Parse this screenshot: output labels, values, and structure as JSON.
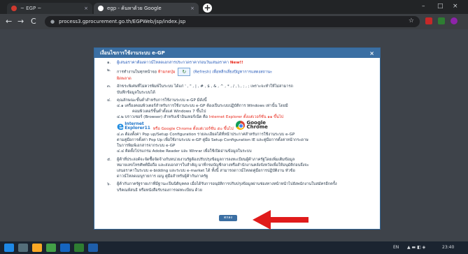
{
  "tabs": [
    {
      "label": "~ EGP ~",
      "close": "×"
    },
    {
      "label": "egp - ค้นหาด้วย Google",
      "close": "×"
    }
  ],
  "new_tab": "+",
  "window_controls": [
    "–",
    "□",
    "×"
  ],
  "nav": {
    "back": "←",
    "forward": "→",
    "reload": "C"
  },
  "address": {
    "url": "process3.gprocurement.go.th/EGPWeb/jsp/index.jsp"
  },
  "bookmark": "☆",
  "dialog": {
    "title": "เงื่อนไขการใช้งานระบบ e-GP",
    "close": "×",
    "items": {
      "i1_num": "๑.",
      "i1_text": "ผู้เสนอราคาต้องดาวน์โหลดเอกสารประกวดราคาก่อนวันเสนอราคา",
      "i1_new": "New!!",
      "i2_num": "๒.",
      "i2_a": "การทำงานในทุกหน้าจอ",
      "i2_b": "ห้ามกดปุ่ม",
      "i2_icon": "↻",
      "i2_c": "(Refresh)",
      "i2_d": "เพื่อหลีกเลี่ยงปัญหาการแสดงสถานะ",
      "i2_e": "ผิดพลาด",
      "i3_num": "๓.",
      "i3_text": "อักขระพิเศษที่ไม่ควรพิมพ์ในระบบ ได้แก่ ' , \" , | , # , $ , & , ^ , * , / , \\ , ; , ; เพราะจะทำให้ไม่สามารถ",
      "i3_text2": "บันทึกข้อมูลในระบบได้",
      "i4_num": "๔.",
      "i4_text": "คุณลักษณะขั้นต่ำสำหรับการใช้งานระบบ e-GP มีดังนี้",
      "i4_1": "๔.๑   เครื่องคอมพิวเตอร์สำหรับการใช้งานระบบ e-GP ต้องเป็นระบบปฏิบัติการ Windows เท่านั้น โดยมี",
      "i4_1b": "คอมพิวเตอร์ขั้นต่ำตั้งแต่ Windows 7 ขึ้นไป",
      "i4_2a": "๔.๒   บราวเซอร์ (Browser) สำหรับเข้าอินเทอร์เน็ต คือ",
      "i4_2b": "Internet Explorer ตั้งแต่เวอร์ชั่น ๑๑ ขึ้นไป",
      "ie_line1": "Internet",
      "ie_line2": "Explorer11",
      "i4_2c": "หรือ Google Chrome ตั้งแต่เวอร์ชั่น ๕๐ ขึ้นไป",
      "chrome_line1": "Google",
      "chrome_line2": "Chrome",
      "i4_3": "๔.๓   ต้องตั้งค่า Pop up/Setup Configuration รายละเอียดได้ที่หน้าประกาศสำหรับการใช้งานระบบ e-GP",
      "i4_3b": "ตามคู่มือการตั้งค่า Pop Up เพื่อใช้งานระบบ e-GP คู่มือ Setup Configuration IE และคู่มือการตั้งค่าหน้ากระดาษ",
      "i4_3c": "ในการพิมพ์เอกสารจากระบบ e-GP",
      "i4_4": "๔.๔   ติดตั้งโปรแกรม Adobe Reader และ Winrar เพื่อใช้เปิดอ่านข้อมูลในระบบ",
      "i5_num": "๕.",
      "i5_text": "ผู้ค้าที่ประสงค์จะจัดซื้อจัดจ้างกับหน่วยงานรัฐต้องปรับปรุงข้อมูลการลงทะเบียนผู้ค้าภาครัฐโดยเพิ่มเติมข้อมูล",
      "i5_text2": "หมายเลขโทรศัพท์มือถือ และส่งเอกสารใบสำคัญ มาที่กรมบัญชีกลางหรือสำนักงานคลังจังหวัดเพื่อให้อนุมัติก่อนจึงจะ",
      "i5_text3": "เสนอราคาในระบบ e-bidding และระบบ e-market ได้ ทั้งนี้ สามารถดาวน์โหลดคู่มือการปฏิบัติงาน หัวข้อ",
      "i5_text4": "ดาวน์โหลดเมนูรายการ เมนู คู่มือสำหรับผู้ค้ากับภาครัฐ",
      "i6_num": "๖.",
      "i6_text": "ผู้ค้ากับภาครัฐรายเก่าที่มีฐานะเป็นนิติบุคคล เมื่อได้รับการอนุมัติการปรับปรุงข้อมูลผ่านช่องทางหน้าหน้าไปยังพนักงานใบสมัครอีกครั้ง",
      "i6_text2": "บริคณห์สนธิ หรือหนังสือรับรองการจดทะเบียน ด้วย"
    },
    "ok_label": "ตกลง"
  },
  "annotation": {
    "arrow_color": "#e01b1b"
  },
  "taskbar": {
    "tray_lang": "EN",
    "clock": "23:40"
  },
  "colors": {
    "accent": "#3b6fa3",
    "alert": "#e8271a",
    "link": "#2459b8"
  }
}
